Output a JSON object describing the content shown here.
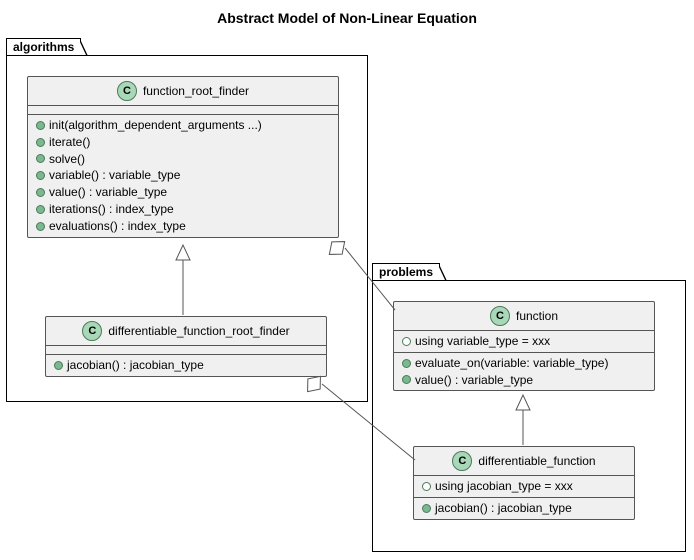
{
  "title": "Abstract Model of Non-Linear Equation",
  "packages": {
    "algorithms": {
      "label": "algorithms"
    },
    "problems": {
      "label": "problems"
    }
  },
  "classes": {
    "function_root_finder": {
      "name": "function_root_finder",
      "badge": "C",
      "members": {
        "m0": "init(algorithm_dependent_arguments ...)",
        "m1": "iterate()",
        "m2": "solve()",
        "m3": "variable() : variable_type",
        "m4": "value() : variable_type",
        "m5": "iterations() : index_type",
        "m6": "evaluations() : index_type"
      }
    },
    "differentiable_function_root_finder": {
      "name": "differentiable_function_root_finder",
      "badge": "C",
      "members": {
        "m0": "jacobian() : jacobian_type"
      }
    },
    "function": {
      "name": "function",
      "badge": "C",
      "sectionA": {
        "m0": "using variable_type = xxx"
      },
      "sectionB": {
        "m0": "evaluate_on(variable: variable_type)",
        "m1": "value() : variable_type"
      }
    },
    "differentiable_function": {
      "name": "differentiable_function",
      "badge": "C",
      "sectionA": {
        "m0": "using jacobian_type = xxx"
      },
      "sectionB": {
        "m0": "jacobian() : jacobian_type"
      }
    }
  }
}
